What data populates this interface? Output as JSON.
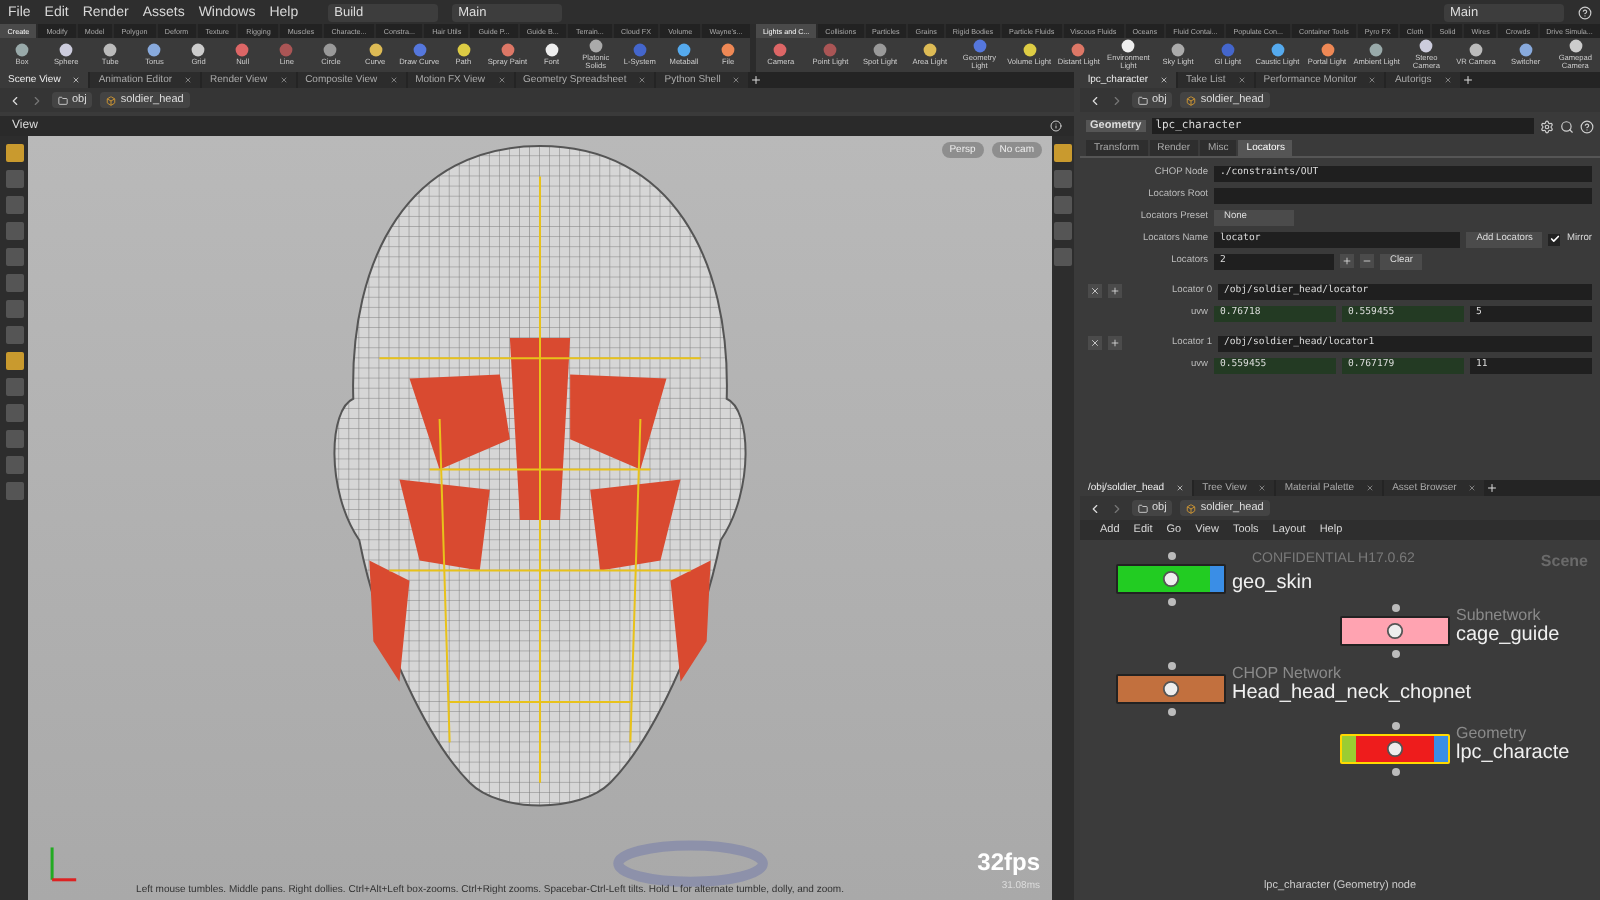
{
  "menu": [
    "File",
    "Edit",
    "Render",
    "Assets",
    "Windows",
    "Help"
  ],
  "desktop_menus": [
    {
      "label": "Build"
    },
    {
      "label": "Main"
    }
  ],
  "right_desktop": {
    "label": "Main"
  },
  "shelves": [
    {
      "tabs": [
        {
          "label": "Create",
          "selected": true
        },
        {
          "label": "Modify",
          "selected": false
        },
        {
          "label": "Model",
          "selected": false
        },
        {
          "label": "Polygon",
          "selected": false
        },
        {
          "label": "Deform",
          "selected": false
        },
        {
          "label": "Texture",
          "selected": false
        },
        {
          "label": "Rigging",
          "selected": false
        },
        {
          "label": "Muscles",
          "selected": false
        },
        {
          "label": "Characte...",
          "selected": false
        },
        {
          "label": "Constra...",
          "selected": false
        },
        {
          "label": "Hair Utils",
          "selected": false
        },
        {
          "label": "Guide P...",
          "selected": false
        },
        {
          "label": "Guide B...",
          "selected": false
        },
        {
          "label": "Terrain...",
          "selected": false
        },
        {
          "label": "Cloud FX",
          "selected": false
        },
        {
          "label": "Volume",
          "selected": false
        },
        {
          "label": "Wayne's...",
          "selected": false
        }
      ],
      "tools": [
        "Box",
        "Sphere",
        "Tube",
        "Torus",
        "Grid",
        "Null",
        "Line",
        "Circle",
        "Curve",
        "Draw Curve",
        "Path",
        "Spray Paint",
        "Font",
        "Platonic Solids",
        "L-System",
        "Metaball",
        "File"
      ]
    },
    {
      "tabs": [
        {
          "label": "Lights and C...",
          "selected": true
        },
        {
          "label": "Collisions",
          "selected": false
        },
        {
          "label": "Particles",
          "selected": false
        },
        {
          "label": "Grains",
          "selected": false
        },
        {
          "label": "Rigid Bodies",
          "selected": false
        },
        {
          "label": "Particle Fluids",
          "selected": false
        },
        {
          "label": "Viscous Fluids",
          "selected": false
        },
        {
          "label": "Oceans",
          "selected": false
        },
        {
          "label": "Fluid Contai...",
          "selected": false
        },
        {
          "label": "Populate Con...",
          "selected": false
        },
        {
          "label": "Container Tools",
          "selected": false
        },
        {
          "label": "Pyro FX",
          "selected": false
        },
        {
          "label": "Cloth",
          "selected": false
        },
        {
          "label": "Solid",
          "selected": false
        },
        {
          "label": "Wires",
          "selected": false
        },
        {
          "label": "Crowds",
          "selected": false
        },
        {
          "label": "Drive Simula...",
          "selected": false
        }
      ],
      "tools": [
        "Camera",
        "Point Light",
        "Spot Light",
        "Area Light",
        "Geometry Light",
        "Volume Light",
        "Distant Light",
        "Environment Light",
        "Sky Light",
        "GI Light",
        "Caustic Light",
        "Portal Light",
        "Ambient Light",
        "Stereo Camera",
        "VR Camera",
        "Switcher",
        "Gamepad Camera"
      ]
    }
  ],
  "scene_pane": {
    "tabs": [
      {
        "label": "Scene View",
        "selected": true
      },
      {
        "label": "Animation Editor",
        "selected": false
      },
      {
        "label": "Render View",
        "selected": false
      },
      {
        "label": "Composite View",
        "selected": false
      },
      {
        "label": "Motion FX View",
        "selected": false
      },
      {
        "label": "Geometry Spreadsheet",
        "selected": false
      },
      {
        "label": "Python Shell",
        "selected": false
      }
    ],
    "path": [
      "obj",
      "soldier_head"
    ],
    "title": "View",
    "view_buttons": [
      "Persp",
      "No cam"
    ],
    "fps": "32fps",
    "frame_time": "31.08ms",
    "hint": "Left mouse tumbles. Middle pans. Right dollies. Ctrl+Alt+Left box-zooms. Ctrl+Right zooms. Spacebar-Ctrl-Left tilts. Hold L for alternate tumble, dolly, and zoom."
  },
  "param_pane": {
    "tabs": [
      {
        "label": "lpc_character",
        "selected": true
      },
      {
        "label": "Take List",
        "selected": false
      },
      {
        "label": "Performance Monitor",
        "selected": false
      },
      {
        "label": "Autorigs",
        "selected": false
      }
    ],
    "path": [
      "obj",
      "soldier_head"
    ],
    "node_type": "Geometry",
    "node_name": "lpc_character",
    "param_tabs": [
      {
        "label": "Transform",
        "selected": false
      },
      {
        "label": "Render",
        "selected": false
      },
      {
        "label": "Misc",
        "selected": false
      },
      {
        "label": "Locators",
        "selected": true
      }
    ],
    "params": [
      {
        "kind": "text",
        "label": "CHOP Node",
        "value": "./constraints/OUT"
      },
      {
        "kind": "text",
        "label": "Locators Root"
      },
      {
        "kind": "menu",
        "label": "Locators Preset",
        "value": "None"
      },
      {
        "kind": "name",
        "label": "Locators Name",
        "value": "locator",
        "button": "Add Locators",
        "checkbox": {
          "label": "Mirror",
          "checked": true
        }
      },
      {
        "kind": "count",
        "label": "Locators",
        "value": "2",
        "button": "Clear"
      }
    ],
    "locators": [
      {
        "label": "Locator 0",
        "path": "/obj/soldier_head/locator",
        "uvw_label": "uvw",
        "uvw": [
          "0.76718",
          "0.559455",
          "5"
        ]
      },
      {
        "label": "Locator 1",
        "path": "/obj/soldier_head/locator1",
        "uvw_label": "uvw",
        "uvw": [
          "0.559455",
          "0.767179",
          "11"
        ]
      }
    ]
  },
  "network_pane": {
    "tabs": [
      {
        "label": "/obj/soldier_head",
        "selected": true
      },
      {
        "label": "Tree View",
        "selected": false
      },
      {
        "label": "Material Palette",
        "selected": false
      },
      {
        "label": "Asset Browser",
        "selected": false
      }
    ],
    "path": [
      "obj",
      "soldier_head"
    ],
    "menu": [
      "Add",
      "Edit",
      "Go",
      "View",
      "Tools",
      "Layout",
      "Help"
    ],
    "watermark": "CONFIDENTIAL H17.0.62",
    "context_label": "Scene",
    "nodes": [
      {
        "name": "geo_skin",
        "color": "#22cc22",
        "selected": false,
        "display_flag": true,
        "template_flag": false
      },
      {
        "type": "Subnetwork",
        "name": "cage_guide",
        "color": "#ffa3b1",
        "selected": false,
        "display_flag": false,
        "template_flag": false
      },
      {
        "type": "CHOP Network",
        "name": "Head_head_neck_chopnet",
        "color": "#c2703e",
        "selected": false,
        "display_flag": false,
        "template_flag": false
      },
      {
        "type": "Geometry",
        "name": "lpc_characte",
        "color": "#ee1c1c",
        "selected": true,
        "display_flag": true,
        "template_flag": true
      }
    ],
    "footer": "lpc_character (Geometry) node"
  }
}
